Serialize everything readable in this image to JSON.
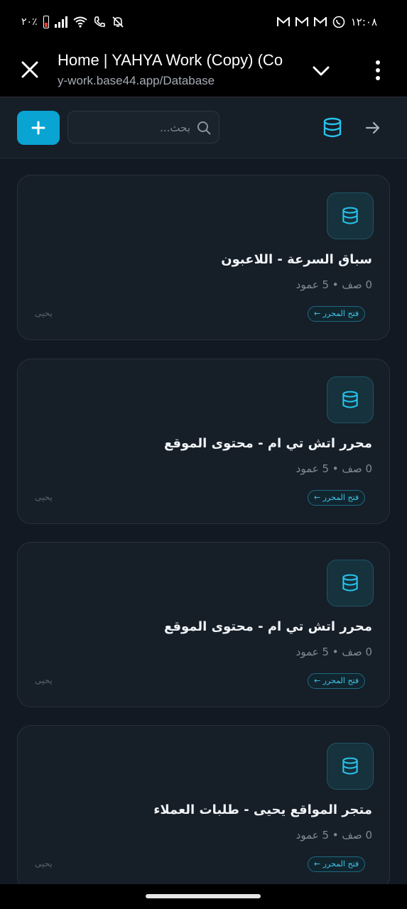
{
  "status": {
    "battery_text": "٢٠٪",
    "time": "١٢:٠٨"
  },
  "browser": {
    "tab_title": "Home | YAHYA Work (Copy) (Co",
    "url": "y-work.base44.app/Database"
  },
  "toolbar": {
    "search_placeholder": "بحث..."
  },
  "cards": [
    {
      "title": "سباق السرعة - اللاعبون",
      "meta": "0 صف • 5 عمود",
      "open_label": "فتح المحرر ←",
      "owner": "يحيى"
    },
    {
      "title": "محرر اتش تي ام - محتوى الموقع",
      "meta": "0 صف • 5 عمود",
      "open_label": "فتح المحرر ←",
      "owner": "يحيى"
    },
    {
      "title": "محرر اتش تي ام - محتوى الموقع",
      "meta": "0 صف • 5 عمود",
      "open_label": "فتح المحرر ←",
      "owner": "يحيى"
    },
    {
      "title": "متجر المواقع يحيى - طلبات العملاء",
      "meta": "0 صف • 5 عمود",
      "open_label": "فتح المحرر ←",
      "owner": "يحيى"
    }
  ],
  "colors": {
    "accent": "#0aa4d3",
    "background": "#121922",
    "card": "#161e28"
  }
}
